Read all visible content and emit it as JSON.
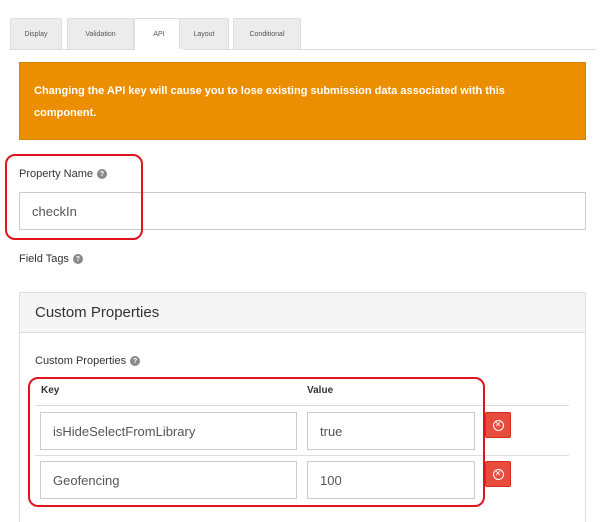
{
  "tabs": [
    {
      "label": "Display",
      "active": false
    },
    {
      "label": "Validation",
      "active": false
    },
    {
      "label": "API",
      "active": true
    },
    {
      "label": "Layout",
      "active": false
    },
    {
      "label": "Conditional",
      "active": false
    }
  ],
  "warning": {
    "line1": "Changing the API key will cause you to lose existing submission data associated with this",
    "line2": "component."
  },
  "property_name": {
    "label": "Property Name",
    "value": "checkIn"
  },
  "field_tags": {
    "label": "Field Tags"
  },
  "custom_properties_panel": {
    "title": "Custom Properties",
    "label": "Custom Properties",
    "columns": {
      "key": "Key",
      "value": "Value"
    },
    "rows": [
      {
        "key": "isHideSelectFromLibrary",
        "value": "true"
      },
      {
        "key": "Geofencing",
        "value": "100"
      }
    ]
  },
  "icons": {
    "help": "question-circle-icon",
    "remove": "remove-circle-icon"
  },
  "colors": {
    "warning_bg": "#eb8f00",
    "highlight": "#e1141e",
    "danger": "#e74c3c"
  },
  "glyphs": {
    "help": "?",
    "remove": "✕"
  }
}
